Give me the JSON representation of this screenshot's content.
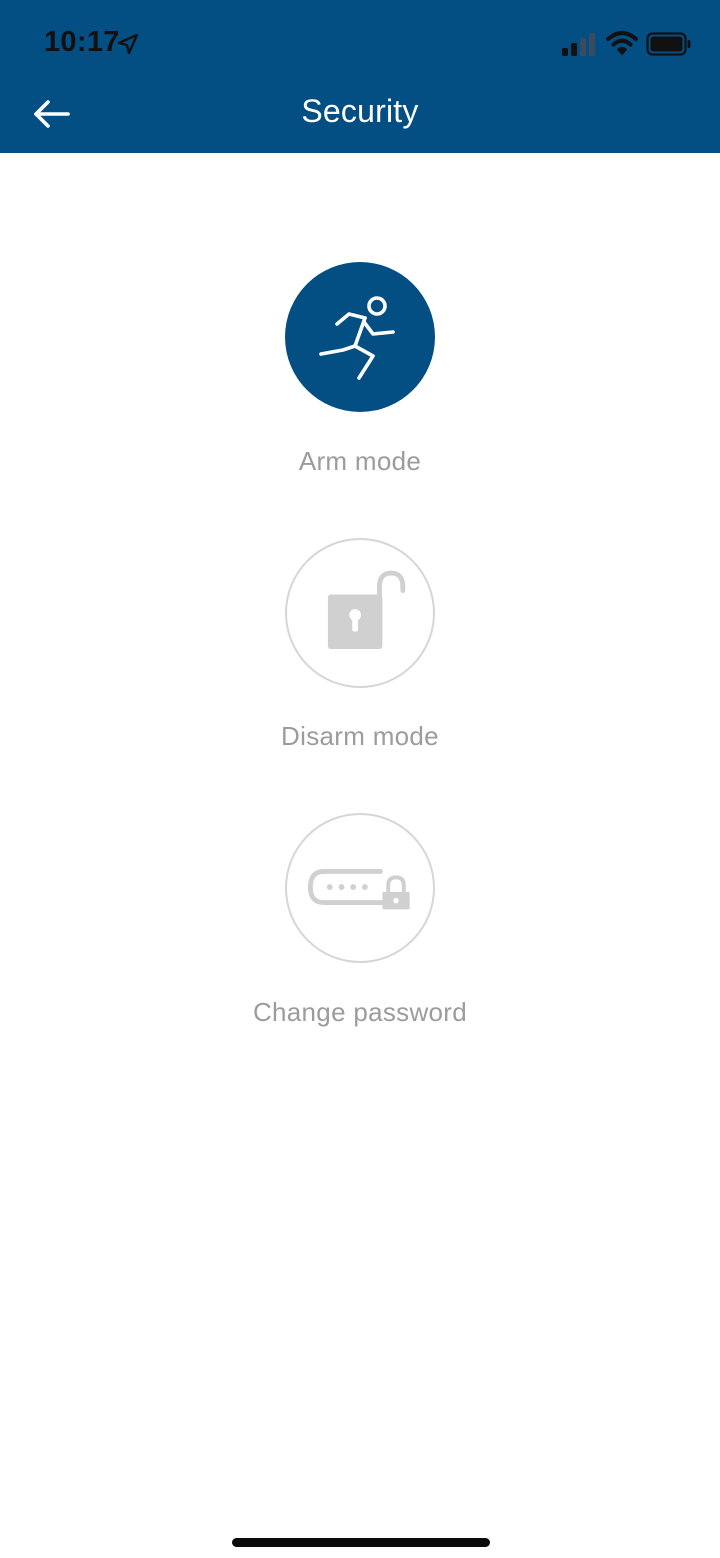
{
  "status_bar": {
    "time": "10:17",
    "icons": [
      "location-arrow-icon",
      "cellular-signal-icon",
      "wifi-icon",
      "battery-icon"
    ]
  },
  "header": {
    "title": "Security",
    "back_icon": "back-arrow-icon",
    "background_color": "#034F83"
  },
  "options": [
    {
      "label": "Arm mode",
      "icon": "running-person-icon",
      "selected": true
    },
    {
      "label": "Disarm mode",
      "icon": "unlocked-padlock-icon",
      "selected": false
    },
    {
      "label": "Change password",
      "icon": "password-lock-icon",
      "selected": false
    }
  ],
  "colors": {
    "accent": "#034F83",
    "inactive_icon": "#d0d0d0",
    "label_text": "#9c9c9c"
  }
}
